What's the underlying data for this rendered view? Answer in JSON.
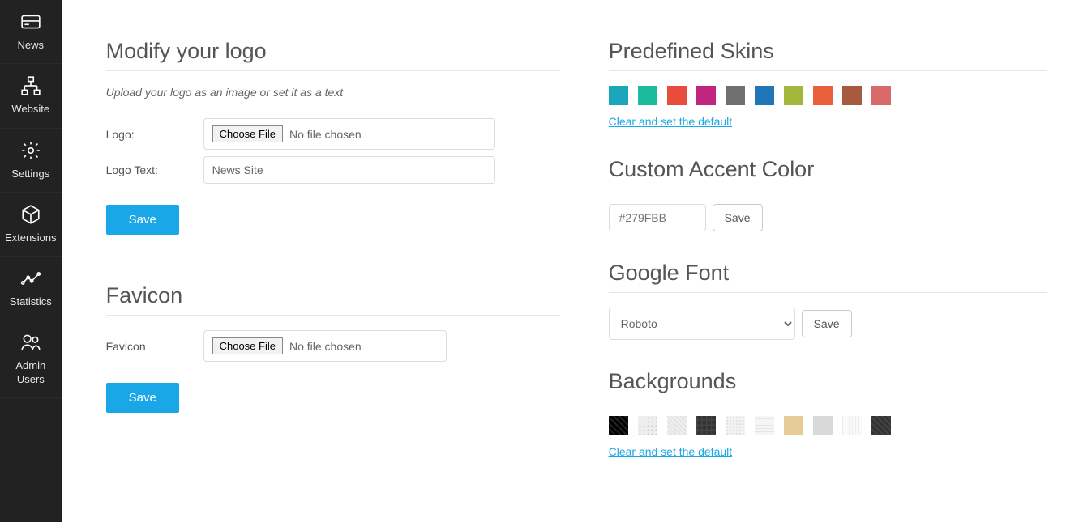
{
  "sidebar": {
    "items": [
      {
        "label": "News"
      },
      {
        "label": "Website"
      },
      {
        "label": "Settings"
      },
      {
        "label": "Extensions"
      },
      {
        "label": "Statistics"
      },
      {
        "label": "Admin Users"
      }
    ]
  },
  "logo": {
    "title": "Modify your logo",
    "hint": "Upload your logo as an image or set it as a text",
    "logo_label": "Logo:",
    "choose_file": "Choose File",
    "no_file": "No file chosen",
    "logo_text_label": "Logo Text:",
    "logo_text_value": "News Site",
    "save": "Save"
  },
  "favicon": {
    "title": "Favicon",
    "label": "Favicon",
    "choose_file": "Choose File",
    "no_file": "No file chosen",
    "save": "Save"
  },
  "skins": {
    "title": "Predefined Skins",
    "colors": [
      "#1aa7bb",
      "#1abc9c",
      "#e74c3c",
      "#c0267f",
      "#6f6f6f",
      "#2176b8",
      "#a3b53a",
      "#e9613b",
      "#a85a3f",
      "#d86a6a"
    ],
    "clear": "Clear and set the default"
  },
  "accent": {
    "title": "Custom Accent Color",
    "placeholder": "#279FBB",
    "save": "Save"
  },
  "font": {
    "title": "Google Font",
    "value": "Roboto",
    "save": "Save"
  },
  "backgrounds": {
    "title": "Backgrounds",
    "clear": "Clear and set the default"
  }
}
